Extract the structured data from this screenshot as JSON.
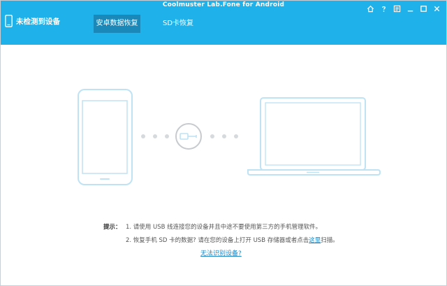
{
  "window": {
    "title": "Coolmuster Lab.Fone for Android",
    "controls": [
      "home-icon",
      "help-icon",
      "feedback-icon",
      "minimize-icon",
      "maximize-icon",
      "close-icon"
    ]
  },
  "device_status": {
    "label": "未检测到设备"
  },
  "tabs": [
    {
      "label": "安卓数据恢复",
      "active": true
    },
    {
      "label": "SD卡恢复",
      "active": false
    }
  ],
  "hints": {
    "label": "提示：",
    "line1": "1. 请使用 USB 线连接您的设备并且中途不要使用第三方的手机管理软件。",
    "line2_prefix": "2. 恢复手机 SD 卡的数据? 请在您的设备上打开 USB 存储器或者点击",
    "line2_link": "这里",
    "line2_suffix": "扫描。"
  },
  "help_link": "无法识别设备?",
  "colors": {
    "accent": "#1fb1ea",
    "active_tab": "#1a88b8",
    "illustration": "#bfe3f4",
    "link": "#1a88c8"
  }
}
